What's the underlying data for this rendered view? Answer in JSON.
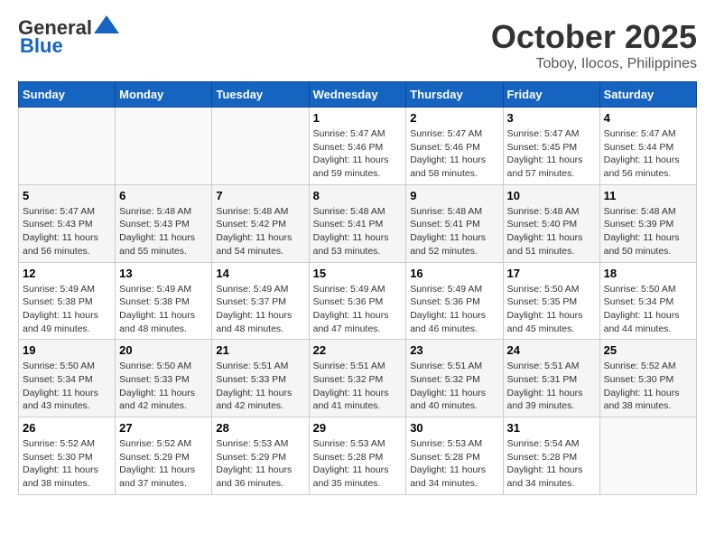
{
  "header": {
    "logo_general": "General",
    "logo_blue": "Blue",
    "month_title": "October 2025",
    "location": "Toboy, Ilocos, Philippines"
  },
  "days_of_week": [
    "Sunday",
    "Monday",
    "Tuesday",
    "Wednesday",
    "Thursday",
    "Friday",
    "Saturday"
  ],
  "weeks": [
    [
      {
        "day": "",
        "info": ""
      },
      {
        "day": "",
        "info": ""
      },
      {
        "day": "",
        "info": ""
      },
      {
        "day": "1",
        "info": "Sunrise: 5:47 AM\nSunset: 5:46 PM\nDaylight: 11 hours\nand 59 minutes."
      },
      {
        "day": "2",
        "info": "Sunrise: 5:47 AM\nSunset: 5:46 PM\nDaylight: 11 hours\nand 58 minutes."
      },
      {
        "day": "3",
        "info": "Sunrise: 5:47 AM\nSunset: 5:45 PM\nDaylight: 11 hours\nand 57 minutes."
      },
      {
        "day": "4",
        "info": "Sunrise: 5:47 AM\nSunset: 5:44 PM\nDaylight: 11 hours\nand 56 minutes."
      }
    ],
    [
      {
        "day": "5",
        "info": "Sunrise: 5:47 AM\nSunset: 5:43 PM\nDaylight: 11 hours\nand 56 minutes."
      },
      {
        "day": "6",
        "info": "Sunrise: 5:48 AM\nSunset: 5:43 PM\nDaylight: 11 hours\nand 55 minutes."
      },
      {
        "day": "7",
        "info": "Sunrise: 5:48 AM\nSunset: 5:42 PM\nDaylight: 11 hours\nand 54 minutes."
      },
      {
        "day": "8",
        "info": "Sunrise: 5:48 AM\nSunset: 5:41 PM\nDaylight: 11 hours\nand 53 minutes."
      },
      {
        "day": "9",
        "info": "Sunrise: 5:48 AM\nSunset: 5:41 PM\nDaylight: 11 hours\nand 52 minutes."
      },
      {
        "day": "10",
        "info": "Sunrise: 5:48 AM\nSunset: 5:40 PM\nDaylight: 11 hours\nand 51 minutes."
      },
      {
        "day": "11",
        "info": "Sunrise: 5:48 AM\nSunset: 5:39 PM\nDaylight: 11 hours\nand 50 minutes."
      }
    ],
    [
      {
        "day": "12",
        "info": "Sunrise: 5:49 AM\nSunset: 5:38 PM\nDaylight: 11 hours\nand 49 minutes."
      },
      {
        "day": "13",
        "info": "Sunrise: 5:49 AM\nSunset: 5:38 PM\nDaylight: 11 hours\nand 48 minutes."
      },
      {
        "day": "14",
        "info": "Sunrise: 5:49 AM\nSunset: 5:37 PM\nDaylight: 11 hours\nand 48 minutes."
      },
      {
        "day": "15",
        "info": "Sunrise: 5:49 AM\nSunset: 5:36 PM\nDaylight: 11 hours\nand 47 minutes."
      },
      {
        "day": "16",
        "info": "Sunrise: 5:49 AM\nSunset: 5:36 PM\nDaylight: 11 hours\nand 46 minutes."
      },
      {
        "day": "17",
        "info": "Sunrise: 5:50 AM\nSunset: 5:35 PM\nDaylight: 11 hours\nand 45 minutes."
      },
      {
        "day": "18",
        "info": "Sunrise: 5:50 AM\nSunset: 5:34 PM\nDaylight: 11 hours\nand 44 minutes."
      }
    ],
    [
      {
        "day": "19",
        "info": "Sunrise: 5:50 AM\nSunset: 5:34 PM\nDaylight: 11 hours\nand 43 minutes."
      },
      {
        "day": "20",
        "info": "Sunrise: 5:50 AM\nSunset: 5:33 PM\nDaylight: 11 hours\nand 42 minutes."
      },
      {
        "day": "21",
        "info": "Sunrise: 5:51 AM\nSunset: 5:33 PM\nDaylight: 11 hours\nand 42 minutes."
      },
      {
        "day": "22",
        "info": "Sunrise: 5:51 AM\nSunset: 5:32 PM\nDaylight: 11 hours\nand 41 minutes."
      },
      {
        "day": "23",
        "info": "Sunrise: 5:51 AM\nSunset: 5:32 PM\nDaylight: 11 hours\nand 40 minutes."
      },
      {
        "day": "24",
        "info": "Sunrise: 5:51 AM\nSunset: 5:31 PM\nDaylight: 11 hours\nand 39 minutes."
      },
      {
        "day": "25",
        "info": "Sunrise: 5:52 AM\nSunset: 5:30 PM\nDaylight: 11 hours\nand 38 minutes."
      }
    ],
    [
      {
        "day": "26",
        "info": "Sunrise: 5:52 AM\nSunset: 5:30 PM\nDaylight: 11 hours\nand 38 minutes."
      },
      {
        "day": "27",
        "info": "Sunrise: 5:52 AM\nSunset: 5:29 PM\nDaylight: 11 hours\nand 37 minutes."
      },
      {
        "day": "28",
        "info": "Sunrise: 5:53 AM\nSunset: 5:29 PM\nDaylight: 11 hours\nand 36 minutes."
      },
      {
        "day": "29",
        "info": "Sunrise: 5:53 AM\nSunset: 5:28 PM\nDaylight: 11 hours\nand 35 minutes."
      },
      {
        "day": "30",
        "info": "Sunrise: 5:53 AM\nSunset: 5:28 PM\nDaylight: 11 hours\nand 34 minutes."
      },
      {
        "day": "31",
        "info": "Sunrise: 5:54 AM\nSunset: 5:28 PM\nDaylight: 11 hours\nand 34 minutes."
      },
      {
        "day": "",
        "info": ""
      }
    ]
  ]
}
